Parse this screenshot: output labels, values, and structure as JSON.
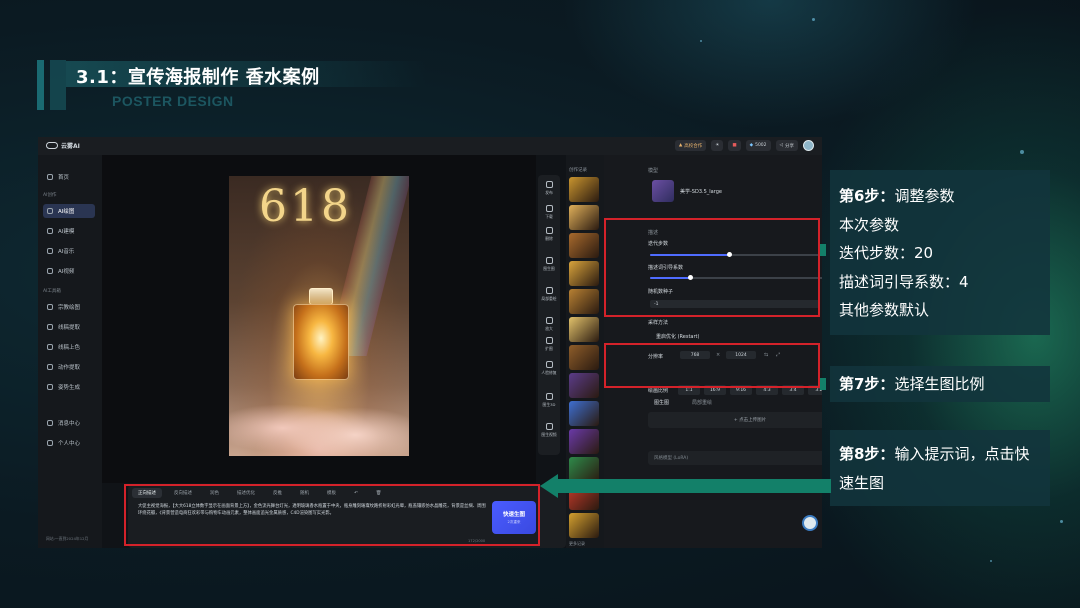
{
  "slide": {
    "title": "3.1：宣传海报制作  香水案例",
    "subtitle": "POSTER DESIGN"
  },
  "app": {
    "logo": "云雾AI",
    "topbar": {
      "promo": "高校合作",
      "credits": "5002",
      "share": "分享"
    },
    "sidebar": {
      "home": "首页",
      "section_create": "AI创作",
      "items": [
        "AI绘图",
        "AI建模",
        "AI音乐",
        "AI视频"
      ],
      "section_tools": "AI工具箱",
      "tools": [
        "宗教绘图",
        "线稿提取",
        "线稿上色",
        "动作提取",
        "姿势生成"
      ],
      "messages": "消息中心",
      "profile": "个人中心",
      "footer": "网站:一直到2024年12月"
    },
    "canvas": {
      "poster_number": "618"
    },
    "tools": [
      "发布",
      "下载",
      "删除",
      "图生图",
      "局部重绘",
      "放大",
      "扩图",
      "人脸修复",
      "图生3D",
      "图生视频"
    ],
    "thumbs": {
      "header": "创作记录",
      "footer": "更多记录",
      "colors": [
        "#c9952f",
        "#e0b05a",
        "#a86a2d",
        "#d9a43c",
        "#b88133",
        "#e2c26b",
        "#8e5d2a",
        "#5b3c8a",
        "#3e6fd1",
        "#6a3aa8",
        "#2e8a4a",
        "#c23a2a",
        "#d3a02f"
      ]
    },
    "panel": {
      "tabs_label": "模型",
      "model_name": "美学-SD3.5_large",
      "section_params": "描述",
      "steps_label": "迭代步数",
      "steps_value": "20",
      "steps_fraction": 0.4,
      "cfg_label": "描述词引导系数",
      "cfg_value": "4",
      "cfg_fraction": 0.2,
      "seed_label": "随机数种子",
      "seed_value": "-1",
      "sampler_label": "采样方法",
      "sampler_value": "重启优化 (Restart)",
      "resolution_label": "分辨率",
      "width": "768",
      "height": "1024",
      "ratio_label": "绘画比例",
      "ratios": [
        "1:1",
        "16:9",
        "9:16",
        "4:3",
        "3:4",
        "3:2"
      ],
      "img2img_label": "图生图",
      "redraw_label": "局部重绘",
      "upload_label": "+ 点击上传图片",
      "lora_label": "风格模型 (LoRA)"
    },
    "prompt": {
      "tab_positive": "正向描述",
      "tab_negative": "反向描述",
      "actions": [
        "润色",
        "描述优化",
        "反推",
        "随机",
        "模板"
      ],
      "text": "大促主视觉海报，【大大618立体数字显示在画面背景上方】，金色流光舞台灯光，透明玻璃香水瓶置于中央，瓶身雕刻璀璨纹路折射彩虹光晕，瓶盖镶嵌仿水晶雕花，背景是丝绸、周围环绕花瓣，《背景营造电商狂欢彩带与购物车动画元素，整体画面追光金属质感，C4D渲染图写实光影。",
      "counter": "172/2000",
      "gen_label": "快速生图",
      "gen_sub": "2次重来",
      "gen_note": "本次生图消耗 2 积分"
    }
  },
  "annotations": {
    "step6": {
      "title": "第6步：",
      "title_rest": "调整参数",
      "lines": [
        "本次参数",
        "迭代步数：20",
        "描述词引导系数：4",
        "其他参数默认"
      ]
    },
    "step7": {
      "title": "第7步：",
      "title_rest": "选择生图比例"
    },
    "step8": {
      "title": "第8步：",
      "title_rest": "输入提示词，点击快",
      "line2": "速生图"
    }
  }
}
